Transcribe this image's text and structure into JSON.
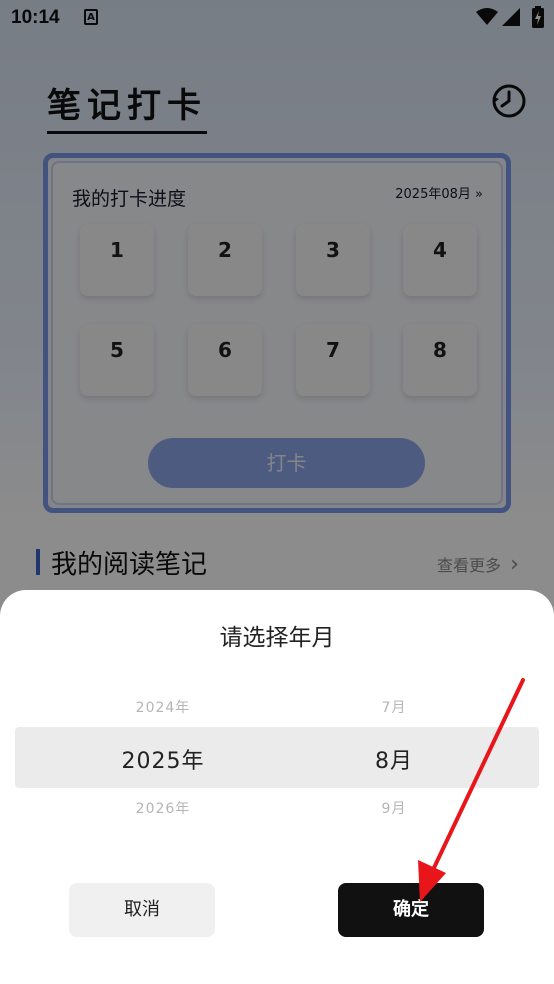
{
  "status_bar": {
    "time": "10:14",
    "icon_letter": "A"
  },
  "header": {
    "title": "笔记打卡"
  },
  "progress_card": {
    "title": "我的打卡进度",
    "date": "2025年08月",
    "date_chevron": "»",
    "days": [
      "1",
      "2",
      "3",
      "4",
      "5",
      "6",
      "7",
      "8"
    ],
    "checkin_label": "打卡"
  },
  "notes": {
    "title": "我的阅读笔记",
    "see_more": "查看更多",
    "see_more_chevron": "›"
  },
  "picker": {
    "title": "请选择年月",
    "years": [
      "2024年",
      "2025年",
      "2026年"
    ],
    "months": [
      "7月",
      "8月",
      "9月"
    ],
    "selected_year": "2025年",
    "selected_month": "8月",
    "cancel_label": "取消",
    "ok_label": "确定"
  },
  "colors": {
    "accent": "#7b98e8",
    "primary_button": "#111111",
    "annotation_arrow": "#e8161b"
  }
}
